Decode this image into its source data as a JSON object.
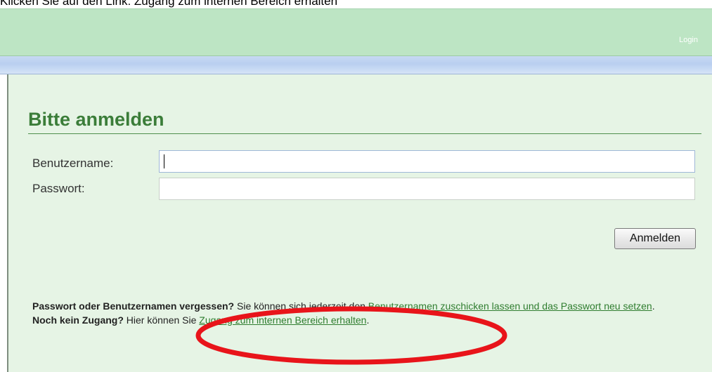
{
  "caption": "Klicken Sie auf den Link: Zugang zum internen Bereich erhalten",
  "header": {
    "login_label": "Login"
  },
  "form": {
    "title": "Bitte anmelden",
    "username_label": "Benutzername:",
    "username_value": "",
    "password_label": "Passwort:",
    "password_value": "",
    "submit_label": "Anmelden"
  },
  "help": {
    "forgot_bold": "Passwort oder Benutzernamen vergessen?",
    "forgot_text": " Sie können sich jederzeit den ",
    "forgot_link": "Benutzernamen zuschicken lassen und das Passwort neu setzen",
    "forgot_end": ".",
    "noaccess_bold": "Noch kein Zugang?",
    "noaccess_text": " Hier können Sie ",
    "noaccess_link": "Zugang zum internen Bereich erhalten",
    "noaccess_end": "."
  },
  "colors": {
    "header_green": "#bde5c4",
    "content_bg": "#e6f4e5",
    "heading_green": "#3b7d39",
    "link_green": "#2f7d2f",
    "annotation_red": "#e8141a"
  },
  "icons": {
    "annotation": "red-ellipse-highlight"
  }
}
